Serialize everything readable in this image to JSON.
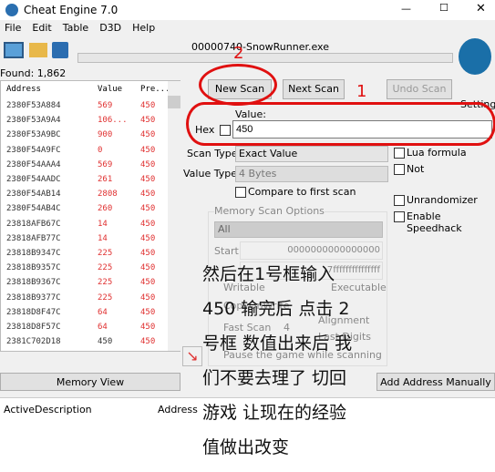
{
  "window": {
    "title": "Cheat Engine 7.0",
    "process": "00000740-SnowRunner.exe"
  },
  "menu": [
    "File",
    "Edit",
    "Table",
    "D3D",
    "Help"
  ],
  "found": "Found: 1,862",
  "list": {
    "headers": [
      "Address",
      "Value",
      "Pre..."
    ],
    "rows": [
      [
        "2380F53A884",
        "569",
        "450"
      ],
      [
        "2380F53A9A4",
        "106...",
        "450"
      ],
      [
        "2380F53A9BC",
        "900",
        "450"
      ],
      [
        "2380F54A9FC",
        "0",
        "450"
      ],
      [
        "2380F54AAA4",
        "569",
        "450"
      ],
      [
        "2380F54AADC",
        "261",
        "450"
      ],
      [
        "2380F54AB14",
        "2808",
        "450"
      ],
      [
        "2380F54AB4C",
        "260",
        "450"
      ],
      [
        "23818AFB67C",
        "14",
        "450"
      ],
      [
        "23818AFB77C",
        "14",
        "450"
      ],
      [
        "23818B9347C",
        "225",
        "450"
      ],
      [
        "23818B9357C",
        "225",
        "450"
      ],
      [
        "23818B9367C",
        "225",
        "450"
      ],
      [
        "23818B9377C",
        "225",
        "450"
      ],
      [
        "23818D8F47C",
        "64",
        "450"
      ],
      [
        "23818D8F57C",
        "64",
        "450"
      ],
      [
        "2381C702D18",
        "450",
        "450"
      ]
    ]
  },
  "buttons": {
    "new_scan": "New Scan",
    "next_scan": "Next Scan",
    "undo_scan": "Undo Scan",
    "memory_view": "Memory View",
    "add_address": "Add Address Manually"
  },
  "settings": "Settings",
  "value": {
    "label": "Value:",
    "hex": "Hex",
    "input": "450"
  },
  "scan_type": {
    "label": "Scan Type",
    "value": "Exact Value"
  },
  "value_type": {
    "label": "Value Type",
    "value": "4 Bytes"
  },
  "compare_first": "Compare to first scan",
  "options": {
    "lua": "Lua formula",
    "not": "Not",
    "unrandomizer": "Unrandomizer",
    "speedhack": "Enable Speedhack"
  },
  "memory": {
    "title": "Memory Scan Options",
    "region": "All",
    "start_label": "Start",
    "start": "0000000000000000",
    "stop": "7fffffffffffffff",
    "writable": "Writable",
    "executable": "Executable",
    "copy_on_write": "CopyOnWrite",
    "fast_scan": "Fast Scan",
    "fast_value": "4",
    "alignment": "Alignment",
    "last_digits": "Last Digits",
    "pause": "Pause the game while scanning"
  },
  "bottom_headers": {
    "active": "Active",
    "description": "Description",
    "address": "Address"
  },
  "annotations": {
    "num1": "1",
    "num2": "2",
    "caption": [
      "然后在1号框输入",
      "450 输完后 点击 2",
      "号框 数值出来后 我",
      "们不要去理了 切回",
      "游戏 让现在的经验",
      "值做出改变"
    ]
  },
  "colors": {
    "changed_value": "#e03030",
    "annotation": "#e01010"
  }
}
